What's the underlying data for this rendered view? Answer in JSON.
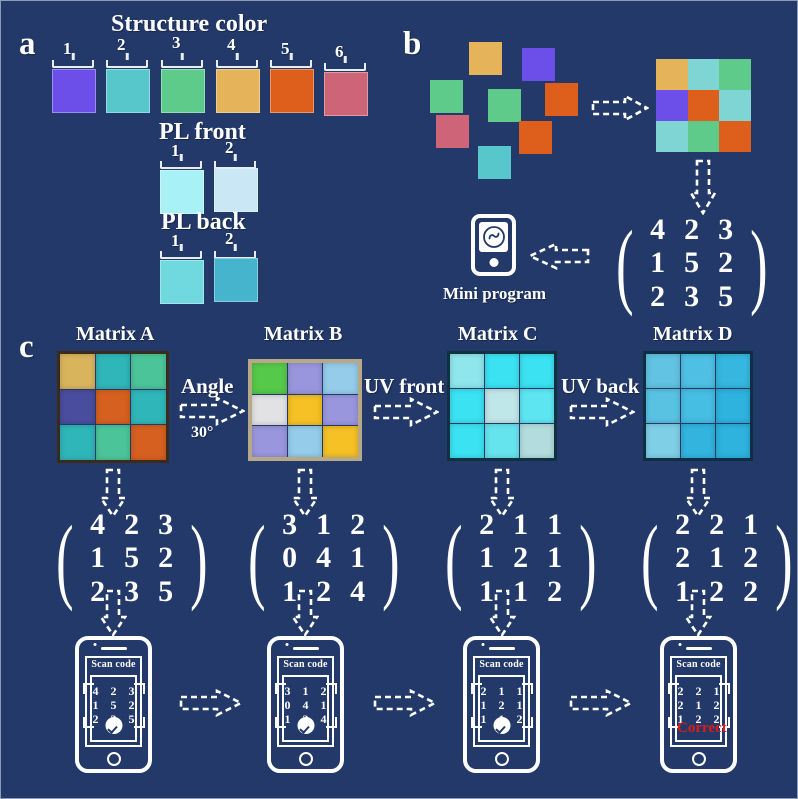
{
  "figure": {
    "background_color": "#23396A",
    "panels": [
      "a",
      "b",
      "c"
    ]
  },
  "panel_a": {
    "letter": "a",
    "groups": [
      {
        "title": "Structure color",
        "swatches": [
          {
            "label": "1",
            "color": "#6C4FE8"
          },
          {
            "label": "2",
            "color": "#58C7CC"
          },
          {
            "label": "3",
            "color": "#5ECB8B"
          },
          {
            "label": "4",
            "color": "#E5B359"
          },
          {
            "label": "5",
            "color": "#DD5F1B"
          },
          {
            "label": "6",
            "color": "#CE6477"
          }
        ]
      },
      {
        "title": "PL front",
        "swatches": [
          {
            "label": "1",
            "color": "#A8F2F7"
          },
          {
            "label": "2",
            "color": "#CAE7F6"
          }
        ]
      },
      {
        "title": "PL back",
        "swatches": [
          {
            "label": "1",
            "color": "#6FD9DF"
          },
          {
            "label": "2",
            "color": "#45B4CC"
          }
        ]
      }
    ]
  },
  "panel_b": {
    "letter": "b",
    "scattered_squares": [
      {
        "color": "#E5B359"
      },
      {
        "color": "#6C4FE8"
      },
      {
        "color": "#5ECB8B"
      },
      {
        "color": "#5ECB8B"
      },
      {
        "color": "#DD5F1B"
      },
      {
        "color": "#CE6477"
      },
      {
        "color": "#DD5F1B"
      },
      {
        "color": "#58C7CC"
      }
    ],
    "assembled_grid": [
      [
        "#E5B359",
        "#7FD4D4",
        "#5ECB8B"
      ],
      [
        "#6C4FE8",
        "#DD5F1B",
        "#7FD4D4"
      ],
      [
        "#7FD4D4",
        "#5ECB8B",
        "#DD5F1B"
      ]
    ],
    "matrix": [
      [
        4,
        2,
        3
      ],
      [
        1,
        5,
        2
      ],
      [
        2,
        3,
        5
      ]
    ],
    "mini_program_label": "Mini program",
    "mini_program_icon": "wechat-mini-program-icon"
  },
  "panel_c": {
    "letter": "c",
    "steps": [
      {
        "title": "Matrix A",
        "photo_tiles": [
          [
            "#D9B45C",
            "#2FB6B8",
            "#4CC49A"
          ],
          [
            "#4A4D9E",
            "#D6601F",
            "#2FB6B8"
          ],
          [
            "#2FB6B8",
            "#4CC49A",
            "#D6601F"
          ]
        ],
        "photo_frame": "#3A2C1C",
        "matrix": [
          [
            4,
            2,
            3
          ],
          [
            1,
            5,
            2
          ],
          [
            2,
            3,
            5
          ]
        ],
        "phone": {
          "scan_label": "Scan code",
          "result_icon": "check-circle-icon",
          "result_text": ""
        }
      },
      {
        "title": "Matrix B",
        "photo_tiles": [
          [
            "#55C94A",
            "#9A96DE",
            "#94CCEA"
          ],
          [
            "#E2E2E4",
            "#F5C124",
            "#9A96DE"
          ],
          [
            "#9A96DE",
            "#94CCEA",
            "#F5C124"
          ]
        ],
        "photo_frame": "#B7A988",
        "matrix": [
          [
            3,
            1,
            2
          ],
          [
            0,
            4,
            1
          ],
          [
            1,
            2,
            4
          ]
        ],
        "phone": {
          "scan_label": "Scan code",
          "result_icon": "check-circle-icon",
          "result_text": ""
        }
      },
      {
        "title": "Matrix C",
        "photo_tiles": [
          [
            "#8FE6EC",
            "#3BE2F2",
            "#3BE2F2"
          ],
          [
            "#3BE2F2",
            "#BFE6E8",
            "#5DE6F2"
          ],
          [
            "#3BE2F2",
            "#66E4EE",
            "#B2DCDD"
          ]
        ],
        "photo_frame": "#10313F",
        "matrix": [
          [
            2,
            1,
            1
          ],
          [
            1,
            2,
            1
          ],
          [
            1,
            1,
            2
          ]
        ],
        "phone": {
          "scan_label": "Scan code",
          "result_icon": "check-circle-icon",
          "result_text": ""
        }
      },
      {
        "title": "Matrix D",
        "photo_tiles": [
          [
            "#62C3E2",
            "#4EC0E4",
            "#35B7E0"
          ],
          [
            "#59C2E3",
            "#46BDE3",
            "#2EB2DE"
          ],
          [
            "#7FCFE6",
            "#32B4DE",
            "#2EB2DE"
          ]
        ],
        "photo_frame": "#0E2E44",
        "matrix": [
          [
            2,
            2,
            1
          ],
          [
            2,
            1,
            2
          ],
          [
            1,
            2,
            2
          ]
        ],
        "phone": {
          "scan_label": "Scan code",
          "result_icon": "",
          "result_text": "Correct"
        }
      }
    ],
    "transitions": [
      {
        "label": "Angle",
        "sublabel": "30°"
      },
      {
        "label": "UV front",
        "sublabel": ""
      },
      {
        "label": "UV back",
        "sublabel": ""
      }
    ],
    "correct_color": "#E01B16"
  }
}
